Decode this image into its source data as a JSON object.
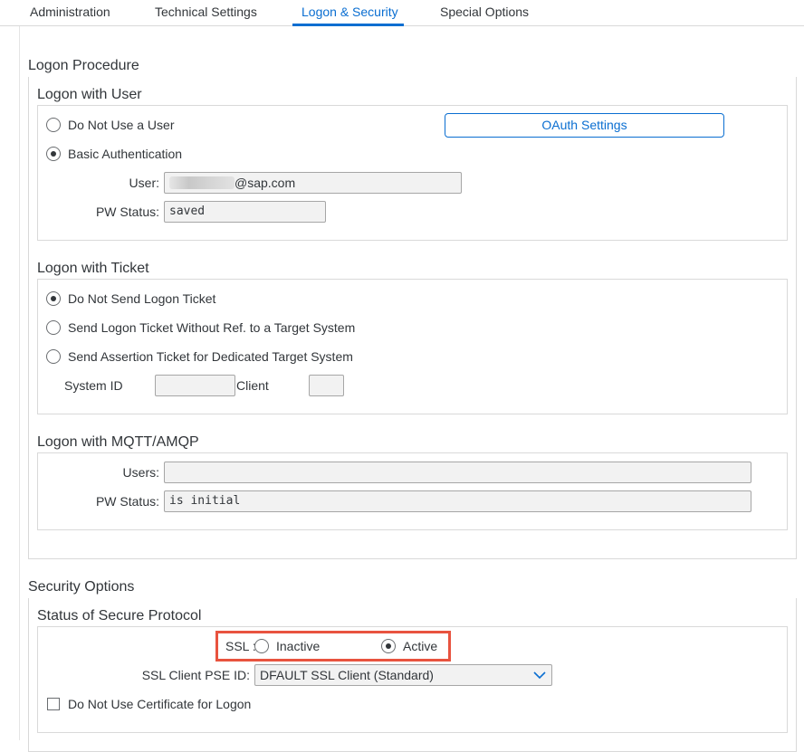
{
  "tabs": [
    {
      "label": "Administration"
    },
    {
      "label": "Technical Settings"
    },
    {
      "label": "Logon & Security"
    },
    {
      "label": "Special Options"
    }
  ],
  "logon_procedure": {
    "title": "Logon Procedure",
    "with_user": {
      "title": "Logon with User",
      "option_no_user": "Do Not Use a User",
      "option_basic": "Basic Authentication",
      "selected": "Basic Authentication",
      "oauth_button": "OAuth Settings",
      "user_label": "User:",
      "user_value_suffix": "@sap.com",
      "pw_status_label": "PW Status:",
      "pw_status_value": "saved"
    },
    "with_ticket": {
      "title": "Logon with Ticket",
      "option_no_send": "Do Not Send Logon Ticket",
      "option_without_ref": "Send Logon Ticket Without Ref. to a Target System",
      "option_assertion": "Send Assertion Ticket for Dedicated Target System",
      "selected": "Do Not Send Logon Ticket",
      "system_id_label": "System ID",
      "system_id_value": "",
      "client_label": "Client",
      "client_value": ""
    },
    "with_mqtt": {
      "title": "Logon with MQTT/AMQP",
      "users_label": "Users:",
      "users_value": "",
      "pw_status_label": "PW Status:",
      "pw_status_value": "is initial"
    }
  },
  "security_options": {
    "title": "Security Options",
    "secure_protocol": {
      "title": "Status of Secure Protocol",
      "ssl_label": "SSL :",
      "ssl_inactive": "Inactive",
      "ssl_active": "Active",
      "ssl_selected": "Active",
      "pse_label": "SSL Client PSE ID:",
      "pse_value": "DFAULT SSL Client (Standard)",
      "no_cert_label": "Do Not Use Certificate for Logon",
      "no_cert_checked": false
    }
  },
  "colors": {
    "accent": "#0a6ed1",
    "highlight": "#e8533f"
  }
}
